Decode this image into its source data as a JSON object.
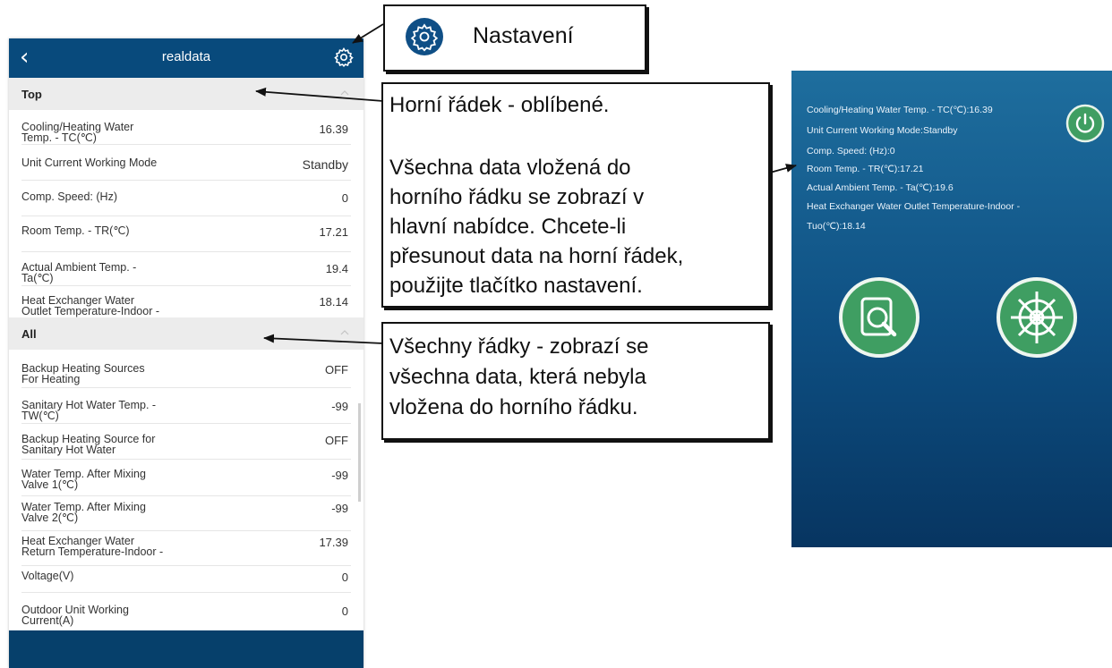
{
  "phone_list": {
    "title": "realdata",
    "back_icon": "chevron-left-icon",
    "settings_icon": "gear-icon",
    "sections": {
      "top": {
        "label": "Top",
        "rows": [
          {
            "label": "Cooling/Heating Water\nTemp. - TC(℃)",
            "value": "16.39"
          },
          {
            "label": "Unit Current Working Mode",
            "value": "Standby"
          },
          {
            "label": "Comp. Speed: (Hz)",
            "value": "0"
          },
          {
            "label": "Room Temp. - TR(℃)",
            "value": "17.21"
          },
          {
            "label": "Actual Ambient Temp. -\nTa(℃)",
            "value": "19.4"
          },
          {
            "label": "Heat Exchanger Water\nOutlet Temperature-Indoor -",
            "value": "18.14"
          }
        ]
      },
      "all": {
        "label": "All",
        "rows": [
          {
            "label": "Backup Heating Sources\nFor Heating",
            "value": "OFF"
          },
          {
            "label": "Sanitary Hot Water Temp. -\nTW(℃)",
            "value": "-99"
          },
          {
            "label": "Backup Heating Source for\nSanitary Hot Water",
            "value": "OFF"
          },
          {
            "label": "Water Temp. After Mixing\nValve 1(℃)",
            "value": "-99"
          },
          {
            "label": "Water Temp. After Mixing\nValve 2(℃)",
            "value": "-99"
          },
          {
            "label": "Heat Exchanger Water\nReturn Temperature-Indoor -",
            "value": "17.39"
          },
          {
            "label": "Voltage(V)",
            "value": "0"
          },
          {
            "label": "Outdoor Unit Working\nCurrent(A)",
            "value": "0"
          }
        ]
      }
    }
  },
  "callouts": {
    "settings": {
      "text": "Nastavení",
      "icon": "gear-icon"
    },
    "top": {
      "line1": "Horní řádek - oblíbené.",
      "lines": [
        "Všechna data vložená do",
        "horního řádku se zobrazí v",
        "hlavní nabídce. Chcete-li",
        "přesunout data na horní řádek,",
        "použijte tlačítko nastavení."
      ]
    },
    "all": {
      "lines": [
        "Všechny řádky - zobrazí se",
        "všechna data, která nebyla",
        "vložena do horního řádku."
      ]
    }
  },
  "phone_main": {
    "lines": [
      "Cooling/Heating Water Temp. - TC(℃):16.39",
      "Unit Current Working Mode:Standby",
      "Comp. Speed: (Hz):0",
      "Room Temp. - TR(℃):17.21",
      "Actual Ambient Temp. - Ta(℃):19.6",
      "Heat Exchanger Water Outlet Temperature-Indoor -",
      "Tuo(℃):18.14"
    ],
    "icons": [
      "power-icon",
      "search-icon",
      "gear-icon"
    ],
    "colors": {
      "bg_top": "#1e6e9e",
      "bg_bottom": "#073561",
      "button_green": "#3f9e62"
    }
  },
  "colors": {
    "header_blue": "#084a7c",
    "section_gray": "#ececec"
  }
}
